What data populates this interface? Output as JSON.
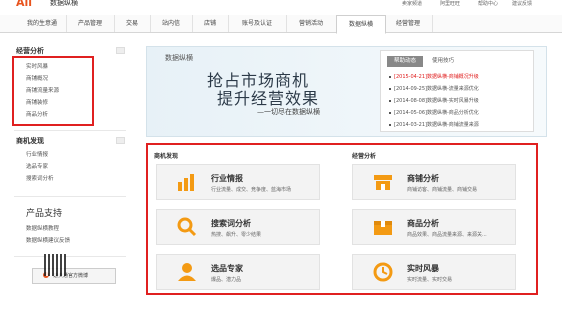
{
  "header": {
    "logo_text": "Ali",
    "logo_suffix": "数据纵横",
    "top_links": [
      "卖家频道",
      "阿里旺旺",
      "帮助中心",
      "建议反馈"
    ]
  },
  "nav": {
    "tabs": [
      "我的生意通",
      "产品管理",
      "交易",
      "站内信",
      "店铺",
      "账号及认证",
      "营销活动",
      "数据纵横",
      "经营管理"
    ],
    "active_index": 7
  },
  "sidebar": {
    "section1_title": "经营分析",
    "section1_items": [
      "实时风暴",
      "商铺概况",
      "商铺流量来源",
      "商铺装修",
      "商品分析"
    ],
    "section2_title": "商机发现",
    "section2_items": [
      "行业情报",
      "选品专家",
      "搜索词分析"
    ],
    "section3_title": "产品支持",
    "section3_items": [
      "数据纵横教程",
      "数据纵横建议反馈"
    ],
    "app_button": "速卖通官方微博"
  },
  "banner": {
    "label": "数据纵横",
    "headline_1": "抢占市场商机",
    "headline_2": "提升经营效果",
    "subline": "—一切尽在数据纵横"
  },
  "news": {
    "tabs": [
      "帮助动态",
      "使用技巧"
    ],
    "items": [
      "[2015-04-21]数据纵横-商铺概况升级",
      "[2014-09-25]数据纵横-流量来源优化",
      "[2014-08-08]数据纵横-实时风暴升级",
      "[2014-05-06]数据纵横-商品分析优化",
      "[2014-03-21]数据纵横-商铺流量来源"
    ]
  },
  "main": {
    "left_title": "商机发现",
    "right_title": "经营分析",
    "cards": [
      {
        "title": "行业情报",
        "desc": "行业流量、成交、竞争度、蓝海市场",
        "icon": "bar-chart-icon",
        "color": "#f39a13"
      },
      {
        "title": "商铺分析",
        "desc": "商铺访客、商铺流量、商铺交易",
        "icon": "shop-icon",
        "color": "#f39a13"
      },
      {
        "title": "搜索词分析",
        "desc": "热搜、飙升、零少结果",
        "icon": "magnifier-icon",
        "color": "#f39a13"
      },
      {
        "title": "商品分析",
        "desc": "商品效果、商品流量来源、来源关...",
        "icon": "box-icon",
        "color": "#f39a13"
      },
      {
        "title": "选品专家",
        "desc": "爆品、潜力品",
        "icon": "person-icon",
        "color": "#f39a13"
      },
      {
        "title": "实时风暴",
        "desc": "实时流量、实时交易",
        "icon": "clock-icon",
        "color": "#f39a13"
      }
    ]
  },
  "colors": {
    "accent": "#f39a13",
    "highlight_border": "#e02020",
    "brand": "#e8541e"
  }
}
